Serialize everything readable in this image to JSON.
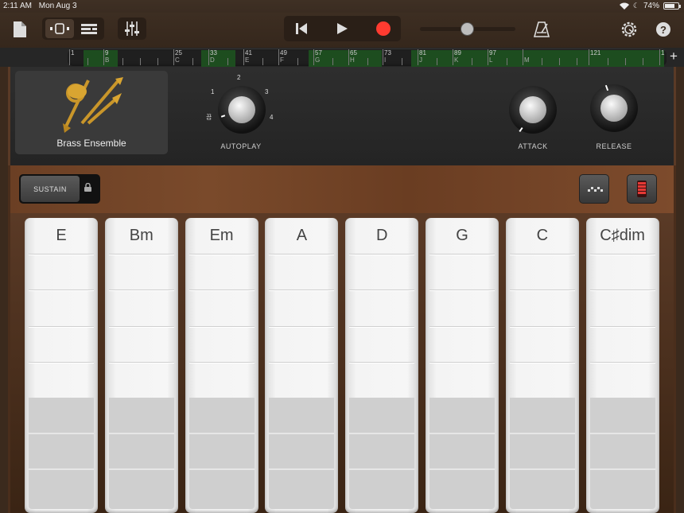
{
  "status": {
    "time": "2:11 AM",
    "date": "Mon Aug 3",
    "battery": "74%",
    "battery_level": 0.74
  },
  "icons": {
    "doc": "document-icon",
    "tracks": "tracks-view-icon",
    "list": "list-view-icon",
    "mixer": "mixer-icon",
    "rewind": "go-to-start-icon",
    "play": "play-icon",
    "record": "record-icon",
    "metronome": "metronome-icon",
    "settings": "settings-gear-icon",
    "help": "help-icon",
    "lock": "lock-icon"
  },
  "colors": {
    "record": "#ff3b30",
    "region": "#1d4d1f",
    "accent_red": "#e53935"
  },
  "volume_level": 0.6,
  "ruler": {
    "bars": [
      {
        "n": "1",
        "letter": ""
      },
      {
        "n": "9",
        "letter": "B"
      },
      {
        "n": "25",
        "letter": "C"
      },
      {
        "n": "33",
        "letter": "D"
      },
      {
        "n": "41",
        "letter": "E"
      },
      {
        "n": "49",
        "letter": "F"
      },
      {
        "n": "57",
        "letter": "G"
      },
      {
        "n": "65",
        "letter": "H"
      },
      {
        "n": "73",
        "letter": "I"
      },
      {
        "n": "81",
        "letter": "J"
      },
      {
        "n": "89",
        "letter": "K"
      },
      {
        "n": "97",
        "letter": "L"
      },
      {
        "n": "",
        "letter": "M"
      },
      {
        "n": "121",
        "letter": ""
      },
      {
        "n": "1",
        "letter": ""
      }
    ],
    "add_label": "+"
  },
  "instrument": {
    "name": "Brass Ensemble"
  },
  "autoplay": {
    "label": "AUTOPLAY",
    "positions": [
      "1",
      "2",
      "3",
      "4"
    ],
    "off_label": "끔"
  },
  "attack": {
    "label": "ATTACK"
  },
  "release": {
    "label": "RELEASE"
  },
  "sustain": {
    "label": "SUSTAIN"
  },
  "chords": [
    "E",
    "Bm",
    "Em",
    "A",
    "D",
    "G",
    "C",
    "C♯dim"
  ]
}
